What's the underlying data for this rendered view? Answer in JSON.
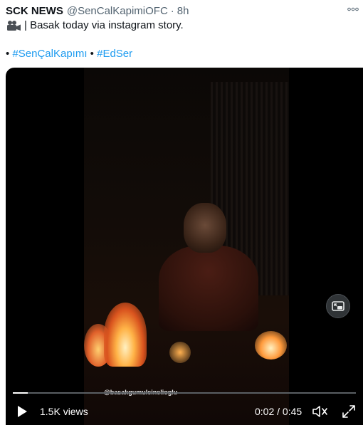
{
  "tweet": {
    "author_name": "SCK NEWS",
    "author_handle": "@SenCalKapimiOFC",
    "separator": "·",
    "time": "8h",
    "text": "| Basak today via instagram story.",
    "text_icon": "video-camera-icon",
    "hashtags": [
      {
        "bullet": "•",
        "label": "#SenÇalKapımı"
      },
      {
        "bullet": "•",
        "label": "#EdSer"
      }
    ],
    "more_icon": "more-options-icon",
    "accent_color": "#1d9bf0"
  },
  "video": {
    "watermark": "@basakgumulcinelioglu",
    "views": "1.5K views",
    "current_time": "0:02",
    "time_separator": " / ",
    "duration": "0:45",
    "progress_percent": 4.4,
    "timecode": "0:02 / 0:45",
    "icons": {
      "play": "play-icon",
      "volume": "volume-icon",
      "fullscreen": "fullscreen-icon",
      "pip": "picture-in-picture-icon"
    }
  }
}
